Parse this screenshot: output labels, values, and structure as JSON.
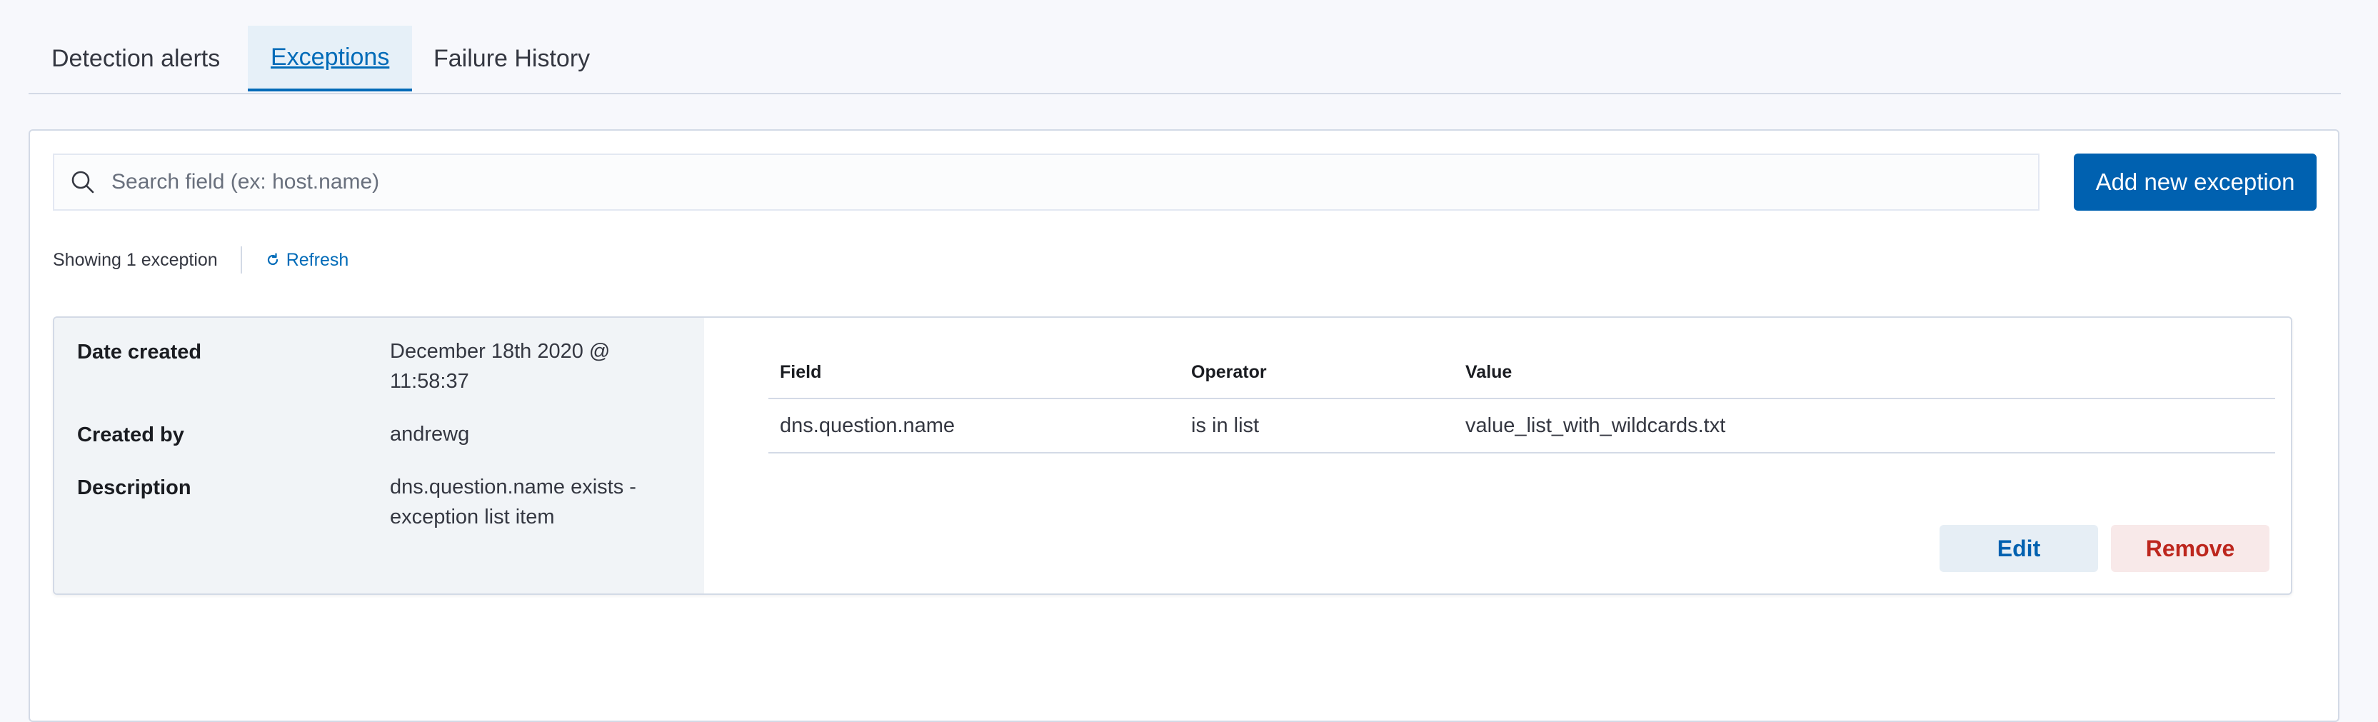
{
  "tabs": [
    {
      "label": "Detection alerts",
      "active": false
    },
    {
      "label": "Exceptions",
      "active": true
    },
    {
      "label": "Failure History",
      "active": false
    }
  ],
  "search": {
    "placeholder": "Search field (ex: host.name)",
    "icon": "search-icon"
  },
  "add_button_label": "Add new exception",
  "utility": {
    "showing": "Showing 1 exception",
    "refresh_label": "Refresh",
    "refresh_icon": "refresh-icon"
  },
  "exception": {
    "meta": [
      {
        "label": "Date created",
        "value": "December 18th 2020 @ 11:58:37"
      },
      {
        "label": "Created by",
        "value": "andrewg"
      },
      {
        "label": "Description",
        "value": "dns.question.name exists - exception list item"
      }
    ],
    "columns": {
      "field": "Field",
      "operator": "Operator",
      "value": "Value"
    },
    "entries": [
      {
        "field": "dns.question.name",
        "operator": "is in list",
        "value": "value_list_with_wildcards.txt"
      }
    ],
    "edit_label": "Edit",
    "remove_label": "Remove"
  },
  "colors": {
    "accent": "#0061b0",
    "danger": "#bd271e",
    "meta_background": "#f1f4f7",
    "border": "#d3dae6"
  }
}
